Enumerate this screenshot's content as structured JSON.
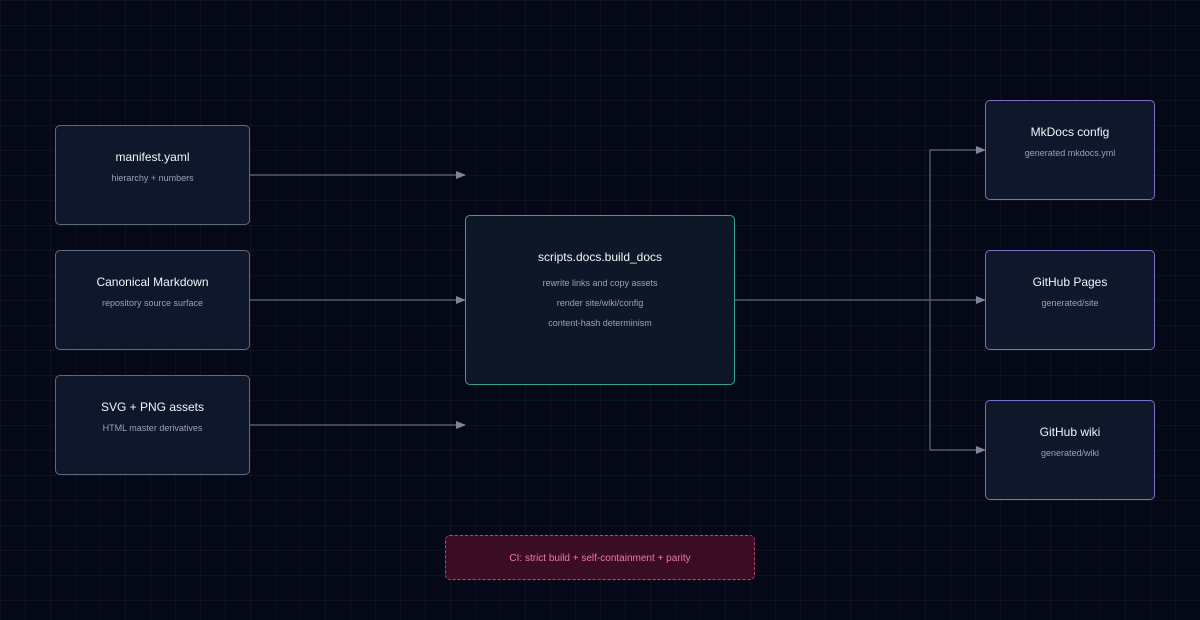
{
  "sources": [
    {
      "title": "manifest.yaml",
      "subtitle": "hierarchy + numbers"
    },
    {
      "title": "Canonical Markdown",
      "subtitle": "repository source surface"
    },
    {
      "title": "SVG + PNG assets",
      "subtitle": "HTML master derivatives"
    }
  ],
  "processor": {
    "title": "scripts.docs.build_docs",
    "lines": [
      "rewrite links and copy assets",
      "render site/wiki/config",
      "content-hash determinism"
    ]
  },
  "outputs": [
    {
      "title": "MkDocs config",
      "subtitle": "generated mkdocs.yml"
    },
    {
      "title": "GitHub Pages",
      "subtitle": "generated/site"
    },
    {
      "title": "GitHub wiki",
      "subtitle": "generated/wiki"
    }
  ],
  "ci": {
    "label": "CI: strict build + self-containment + parity"
  },
  "colors": {
    "background": "#050816",
    "node_fill": "#0f172a",
    "source_border": "#5b6b7e",
    "processor_border": "#2fa58a",
    "output_border": "#7d6fc8",
    "ci_border": "#b34869",
    "ci_text": "#f17a9a",
    "connector": "#64748b"
  }
}
